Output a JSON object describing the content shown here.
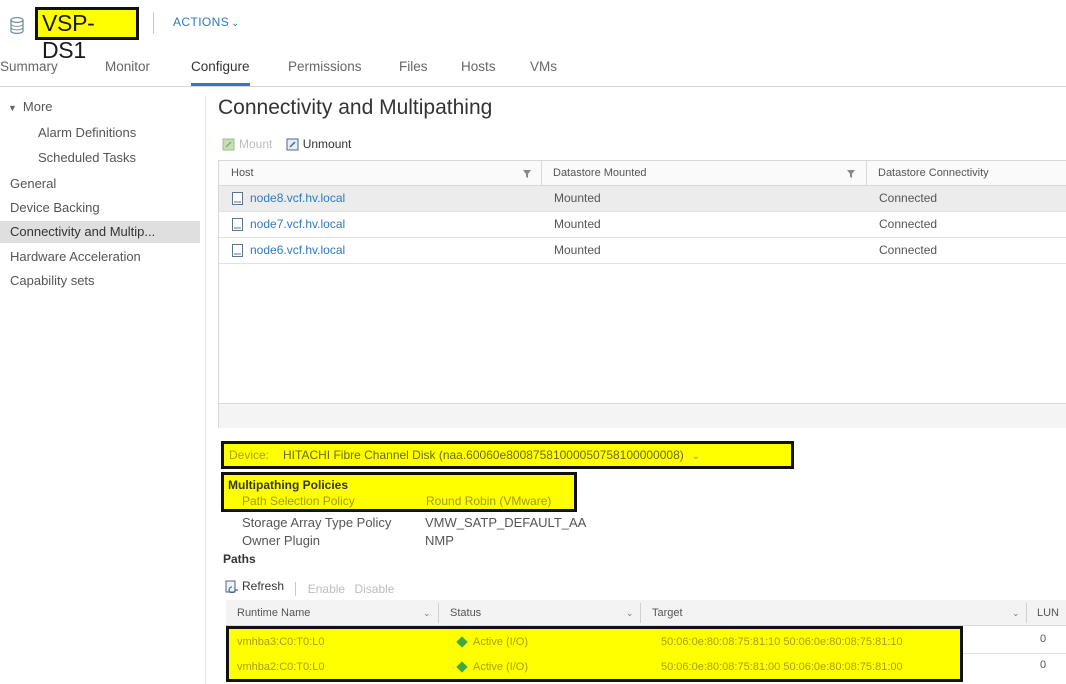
{
  "header": {
    "title": "VSP-DS1",
    "actions_label": "ACTIONS",
    "icon": "datastore-icon"
  },
  "tabs": [
    {
      "label": "Summary"
    },
    {
      "label": "Monitor"
    },
    {
      "label": "Configure",
      "active": true
    },
    {
      "label": "Permissions"
    },
    {
      "label": "Files"
    },
    {
      "label": "Hosts"
    },
    {
      "label": "VMs"
    }
  ],
  "sidebar": {
    "items": [
      {
        "label": "More",
        "expanded": true
      },
      {
        "label": "Alarm Definitions"
      },
      {
        "label": "Scheduled Tasks"
      },
      {
        "label": "General"
      },
      {
        "label": "Device Backing"
      },
      {
        "label": "Connectivity and Multip...",
        "selected": true
      },
      {
        "label": "Hardware Acceleration"
      },
      {
        "label": "Capability sets"
      }
    ]
  },
  "main": {
    "title": "Connectivity and Multipathing",
    "toolbar": {
      "mount_label": "Mount",
      "unmount_label": "Unmount"
    },
    "hosts_table": {
      "columns": [
        "Host",
        "Datastore Mounted",
        "Datastore Connectivity"
      ],
      "rows": [
        {
          "host": "node8.vcf.hv.local",
          "mounted": "Mounted",
          "connectivity": "Connected",
          "selected": true
        },
        {
          "host": "node7.vcf.hv.local",
          "mounted": "Mounted",
          "connectivity": "Connected"
        },
        {
          "host": "node6.vcf.hv.local",
          "mounted": "Mounted",
          "connectivity": "Connected"
        }
      ]
    },
    "device": {
      "label": "Device:",
      "value": "HITACHI Fibre Channel Disk (naa.60060e80087581000050758100000008)"
    },
    "multipathing": {
      "title": "Multipathing Policies",
      "path_selection_policy_label": "Path Selection Policy",
      "path_selection_policy_value": "Round Robin (VMware)",
      "storage_array_type_policy_label": "Storage Array Type Policy",
      "storage_array_type_policy_value": "VMW_SATP_DEFAULT_AA",
      "owner_plugin_label": "Owner Plugin",
      "owner_plugin_value": "NMP"
    },
    "paths": {
      "title": "Paths",
      "toolbar": {
        "refresh_label": "Refresh",
        "enable_label": "Enable",
        "disable_label": "Disable"
      },
      "columns": [
        "Runtime Name",
        "Status",
        "Target",
        "LUN"
      ],
      "rows": [
        {
          "runtime_name": "vmhba3:C0:T0:L0",
          "status": "Active (I/O)",
          "target": "50:06:0e:80:08:75:81:10 50:06:0e:80:08:75:81:10",
          "lun": "0"
        },
        {
          "runtime_name": "vmhba2:C0:T0:L0",
          "status": "Active (I/O)",
          "target": "50:06:0e:80:08:75:81:00 50:06:0e:80:08:75:81:00",
          "lun": "0"
        }
      ]
    }
  },
  "colors": {
    "accent": "#2f7ac0",
    "highlight": "#ffff00",
    "status_active": "#3fa93f"
  }
}
